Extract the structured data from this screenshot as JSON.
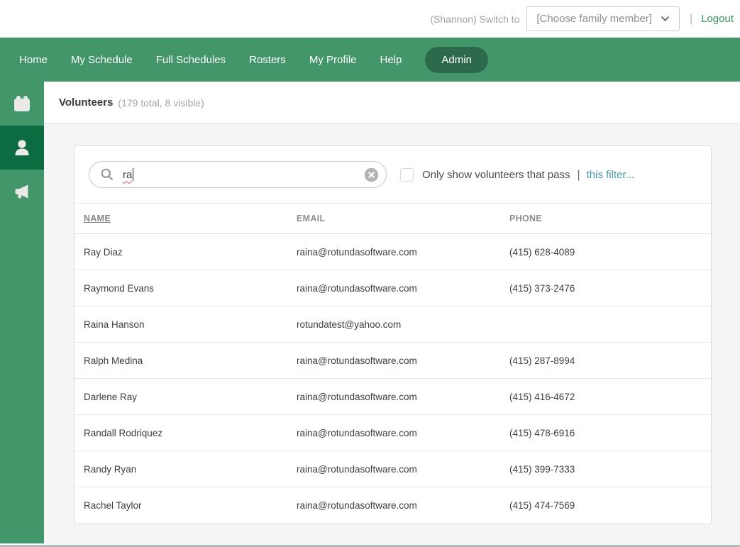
{
  "topbar": {
    "switch_label": "(Shannon) Switch to",
    "family_dropdown_value": "[Choose family member]",
    "separator": "|",
    "logout_label": "Logout"
  },
  "nav": {
    "items": [
      {
        "label": "Home",
        "active": false
      },
      {
        "label": "My Schedule",
        "active": false
      },
      {
        "label": "Full Schedules",
        "active": false
      },
      {
        "label": "Rosters",
        "active": false
      },
      {
        "label": "My Profile",
        "active": false
      },
      {
        "label": "Help",
        "active": false
      },
      {
        "label": "Admin",
        "active": true
      }
    ]
  },
  "sidebar": {
    "items": [
      {
        "icon": "calendar-icon",
        "active": false
      },
      {
        "icon": "person-icon",
        "active": true
      },
      {
        "icon": "megaphone-icon",
        "active": false
      }
    ]
  },
  "page": {
    "title": "Volunteers",
    "subtitle": "(179 total, 8 visible)"
  },
  "search": {
    "value": "ra",
    "icons": {
      "search": "magnifier-icon",
      "clear": "circle-x-icon"
    }
  },
  "filter": {
    "checked": false,
    "label": "Only show volunteers that pass",
    "separator": "|",
    "link_label": "this filter..."
  },
  "table": {
    "columns": [
      "NAME",
      "EMAIL",
      "PHONE"
    ],
    "sorted_column": "NAME",
    "rows": [
      {
        "name": "Ray Diaz",
        "email": "raina@rotundasoftware.com",
        "phone": "(415) 628-4089"
      },
      {
        "name": "Raymond Evans",
        "email": "raina@rotundasoftware.com",
        "phone": "(415) 373-2476"
      },
      {
        "name": "Raina Hanson",
        "email": "rotundatest@yahoo.com",
        "phone": ""
      },
      {
        "name": "Ralph Medina",
        "email": "raina@rotundasoftware.com",
        "phone": "(415) 287-8994"
      },
      {
        "name": "Darlene Ray",
        "email": "raina@rotundasoftware.com",
        "phone": "(415) 416-4672"
      },
      {
        "name": "Randall Rodriquez",
        "email": "raina@rotundasoftware.com",
        "phone": "(415) 478-6916"
      },
      {
        "name": "Randy Ryan",
        "email": "raina@rotundasoftware.com",
        "phone": "(415) 399-7333"
      },
      {
        "name": "Rachel Taylor",
        "email": "raina@rotundasoftware.com",
        "phone": "(415) 474-7569"
      }
    ]
  },
  "colors": {
    "nav_green": "#42966a",
    "active_sidebar_green": "#0d6b42",
    "admin_pill_green": "#2d6a4b",
    "logout_green": "#37945e",
    "filter_link_teal": "#4596a8",
    "content_bg": "#f4f5f4",
    "spellcheck_red": "#d9534f"
  }
}
